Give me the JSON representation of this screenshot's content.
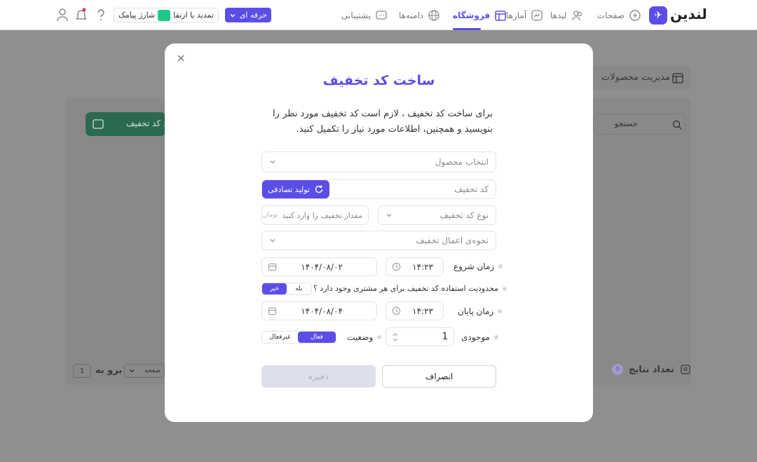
{
  "topbar": {
    "logo_text": "لندین",
    "nav": {
      "pages": "صفحات",
      "leads": "لیدها",
      "stats": "آمارها",
      "shop": "فروشگاه",
      "domains": "دامنه‌ها",
      "support": "پشتیبانی"
    },
    "plan_label": "حرفه ای",
    "renew_label": "تمدید یا ارتقا",
    "sms_label": "شارژ پیامک"
  },
  "background": {
    "section_title": "مدیریت محصولات",
    "search_placeholder": "جستجو",
    "discount_count_label": "تعداد کد تخفیف",
    "results_label": "تعداد نتایج",
    "results_count": "0",
    "goto_label": "برو به",
    "goto_page": "1",
    "page_label": "صفحه"
  },
  "modal": {
    "title": "ساخت کد تخفیف",
    "description": "برای ساخت کد تخفیف ، لازم است کد تخفیف مورد نظر را بنویسید و همچنین، اطلاعات مورد نیاز را تکمیل کنید.",
    "product_placeholder": "انتخاب محصول",
    "code_placeholder": "کد تخفیف",
    "generate_label": "تولید تصادفی",
    "type_placeholder": "نوع کد تخفیف",
    "amount_placeholder": "مقدار تخفیف را وارد کنید",
    "amount_unit": "تومان",
    "apply_placeholder": "نحوه‌ی اعمال تخفیف",
    "start_label": "زمان شروع",
    "start_time": "۱۴:۲۳",
    "start_date": "۱۴۰۴/۰۸/۰۲",
    "limit_question": "محدودیت استفاده کد تخفیف برای هر مشتری وجود دارد ؟",
    "yes_label": "بله",
    "no_label": "خیر",
    "end_label": "زمان پایان",
    "end_time": "۱۴:۲۳",
    "end_date": "۱۴۰۴/۰۸/۰۴",
    "stock_label": "موجودی",
    "stock_value": "1",
    "status_label": "وضعیت",
    "active_label": "فعال",
    "inactive_label": "غیرفعال",
    "save_label": "ذخیره",
    "cancel_label": "انصراف"
  },
  "colors": {
    "accent": "#5b4ee8",
    "sms_green": "#1ec987",
    "overlay": "#8f8f8f"
  }
}
